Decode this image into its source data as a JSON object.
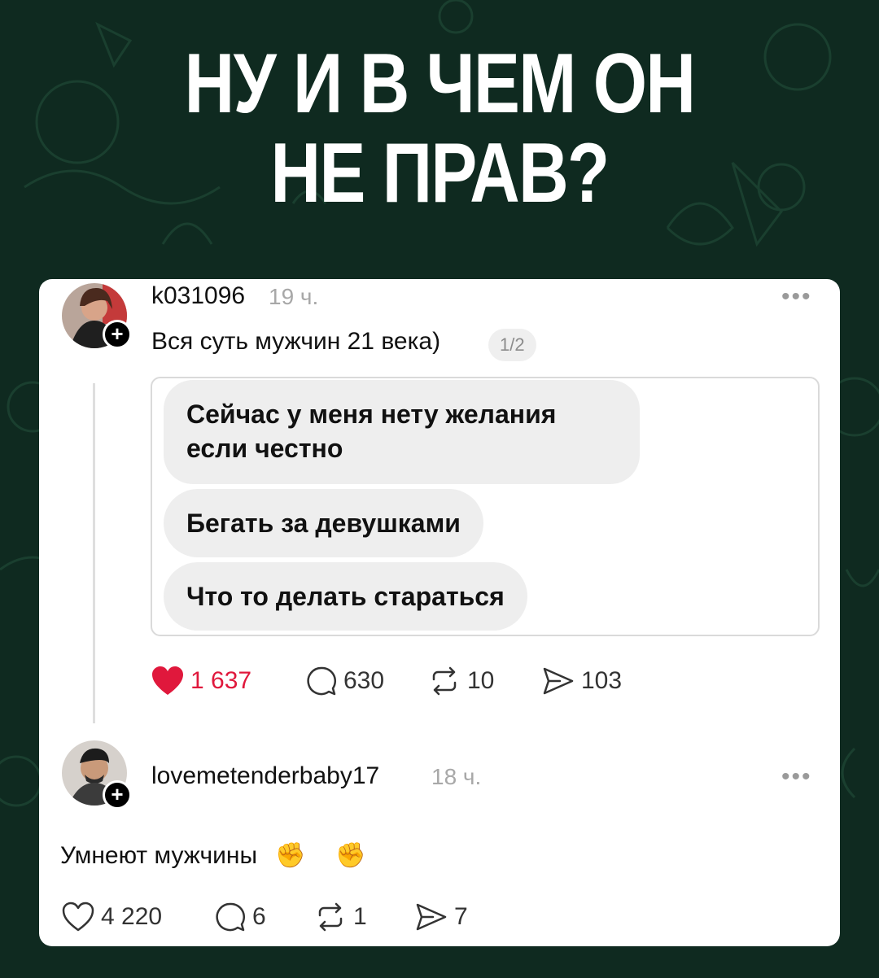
{
  "headline": {
    "line1": "НУ И В ЧЕМ ОН",
    "line2": "НЕ ПРАВ?"
  },
  "post": {
    "username": "k031096",
    "time": "19 ч.",
    "more_icon": "more-horizontal-icon",
    "text": "Вся суть мужчин 21 века)",
    "page_indicator": "1/2",
    "messages": [
      "Сейчас у меня нету желания если честно",
      "Бегать за девушками",
      "Что то делать стараться"
    ],
    "likes": "1 637",
    "comments": "630",
    "reposts": "10",
    "shares": "103",
    "liked": true,
    "like_color": "#e0183c"
  },
  "reply": {
    "username": "lovemetenderbaby17",
    "time": "18 ч.",
    "more_icon": "more-horizontal-icon",
    "text": "Умнеют мужчины",
    "emoji": "✊ ✊",
    "likes": "4 220",
    "comments": "6",
    "reposts": "1",
    "shares": "7"
  },
  "colors": {
    "background": "#0f2a20",
    "card": "#ffffff",
    "bubble": "#eeeeee",
    "muted": "#a8a8a8"
  }
}
